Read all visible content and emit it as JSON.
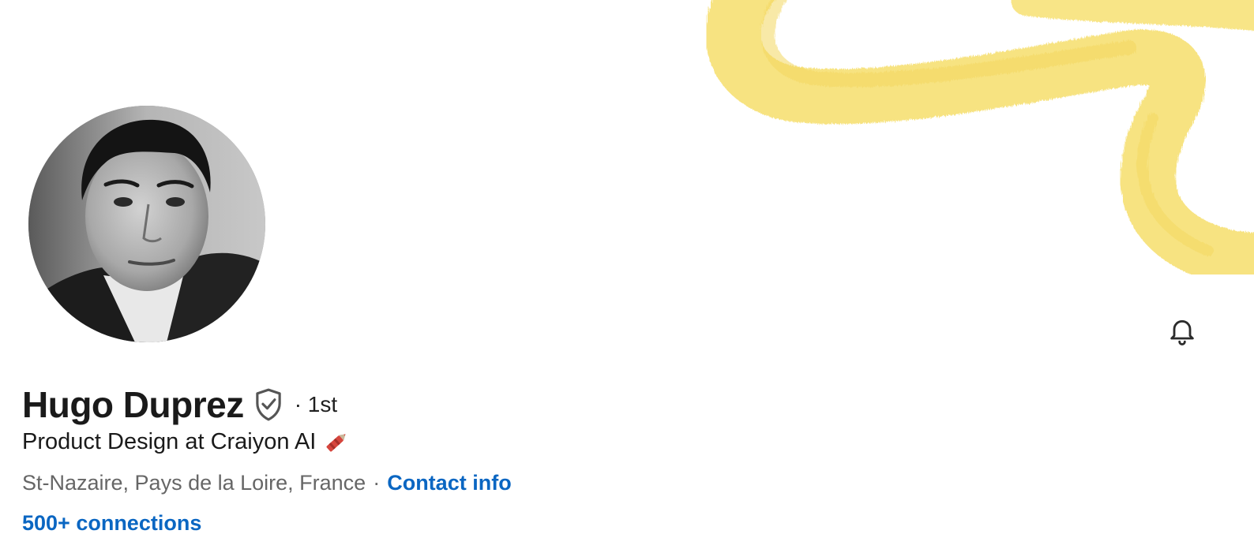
{
  "profile": {
    "name": "Hugo Duprez",
    "degree": "· 1st",
    "headline": "Product Design at Craiyon AI",
    "location": "St-Nazaire, Pays de la Loire, France",
    "separator": "·",
    "contact_info_label": "Contact info",
    "connections_label": "500+ connections"
  },
  "icons": {
    "verified": "verified-shield-icon",
    "headline_emoji": "crayon-icon",
    "notifications": "bell-icon"
  },
  "colors": {
    "banner_stroke": "#f7e27a",
    "link": "#0a66c2",
    "secondary_text": "#666666",
    "primary_text": "#1a1a1a"
  }
}
